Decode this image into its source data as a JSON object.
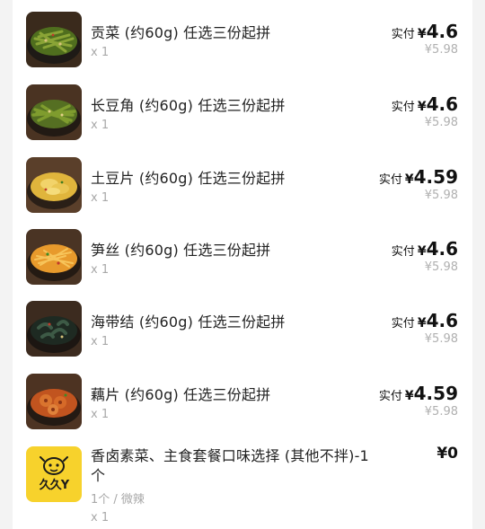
{
  "items": [
    {
      "name": "贡菜 (约60g) 任选三份起拼",
      "qty": "x 1",
      "paid_label": "实付",
      "currency": "¥",
      "paid": "4.6",
      "original": "¥5.98",
      "image": "green-vegetable-dish"
    },
    {
      "name": "长豆角 (约60g) 任选三份起拼",
      "qty": "x 1",
      "paid_label": "实付",
      "currency": "¥",
      "paid": "4.6",
      "original": "¥5.98",
      "image": "green-bean-dish"
    },
    {
      "name": "土豆片 (约60g) 任选三份起拼",
      "qty": "x 1",
      "paid_label": "实付",
      "currency": "¥",
      "paid": "4.59",
      "original": "¥5.98",
      "image": "potato-slice-dish"
    },
    {
      "name": "笋丝 (约60g) 任选三份起拼",
      "qty": "x 1",
      "paid_label": "实付",
      "currency": "¥",
      "paid": "4.6",
      "original": "¥5.98",
      "image": "bamboo-shoot-dish"
    },
    {
      "name": "海带结 (约60g) 任选三份起拼",
      "qty": "x 1",
      "paid_label": "实付",
      "currency": "¥",
      "paid": "4.6",
      "original": "¥5.98",
      "image": "kelp-knot-dish"
    },
    {
      "name": "藕片 (约60g) 任选三份起拼",
      "qty": "x 1",
      "paid_label": "实付",
      "currency": "¥",
      "paid": "4.59",
      "original": "¥5.98",
      "image": "lotus-root-dish"
    }
  ],
  "combo": {
    "name": "香卤素菜、主食套餐口味选择 (其他不拌)-1个",
    "spec": "1个 / 微辣",
    "qty": "x 1",
    "price": "¥0",
    "logo_text": "久久Y",
    "image": "brand-logo"
  },
  "colors": {
    "logo_bg": "#f7d22c",
    "price": "#111111",
    "muted": "#a8a8a8"
  }
}
